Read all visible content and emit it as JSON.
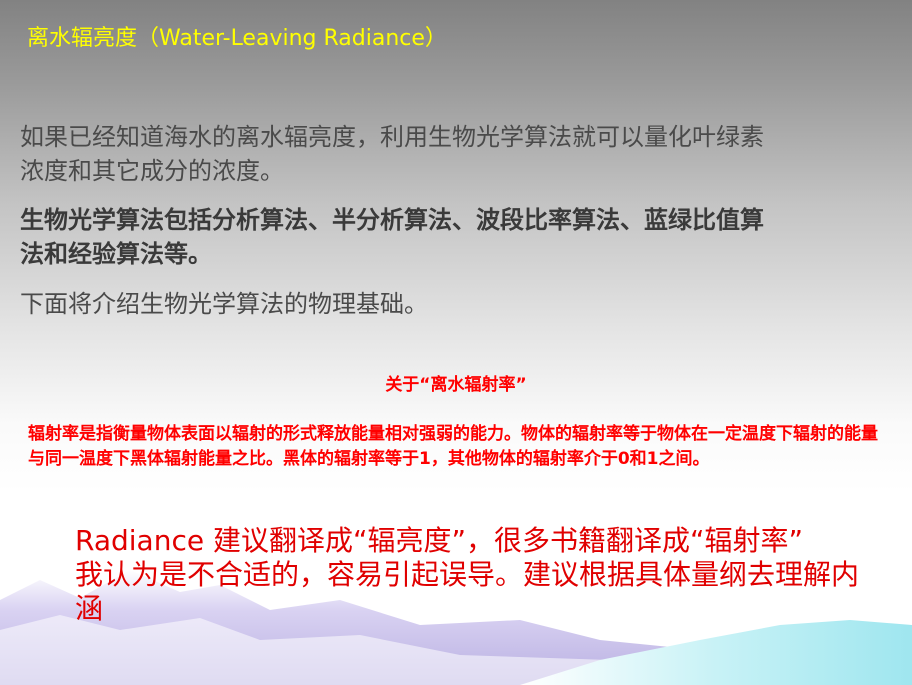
{
  "slide": {
    "title": "离水辐亮度（Water-Leaving Radiance）",
    "paragraph1": "如果已经知道海水的离水辐亮度，利用生物光学算法就可以量化叶绿素浓度和其它成分的浓度。",
    "paragraph2": "生物光学算法包括分析算法、半分析算法、波段比率算法、蓝绿比值算法和经验算法等。",
    "paragraph3": "下面将介绍生物光学算法的物理基础。",
    "box_title": "关于“离水辐射率”",
    "box_body": "辐射率是指衡量物体表面以辐射的形式释放能量相对强弱的能力。物体的辐射率等于物体在一定温度下辐射的能量与同一温度下黑体辐射能量之比。黑体的辐射率等于1，其他物体的辐射率介于0和1之间。",
    "note_line1": "Radiance 建议翻译成“辐亮度”，很多书籍翻译成“辐射率”",
    "note_line2": "我认为是不合适的，容易引起误导。建议根据具体量纲去理解内涵"
  },
  "colors": {
    "title": "#ffff00",
    "body_text": "#4a4a4a",
    "highlight_red": "#ff0000",
    "mountain_purple": "#c8bfe8",
    "mountain_blue": "#a8e8f0"
  }
}
